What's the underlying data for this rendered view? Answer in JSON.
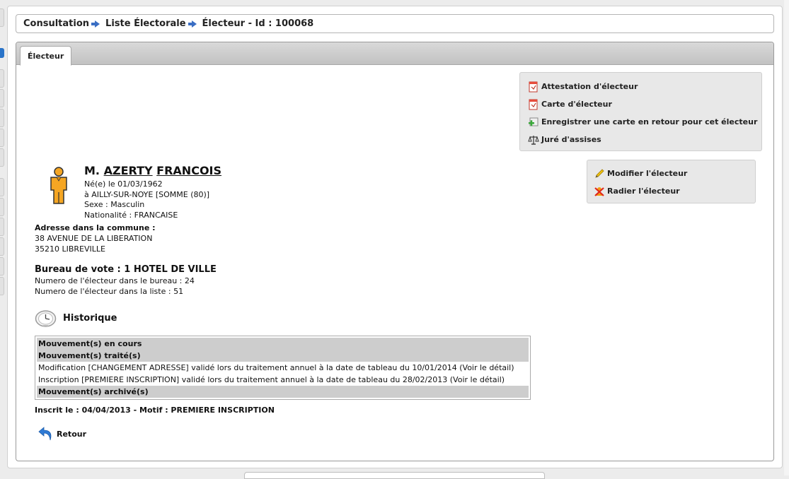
{
  "breadcrumb": {
    "item1": "Consultation",
    "item2": "Liste Électorale",
    "item3": "Électeur - Id : 100068"
  },
  "tabs": [
    {
      "label": "Électeur"
    }
  ],
  "actions": {
    "attestation": "Attestation d'électeur",
    "carte": "Carte d'électeur",
    "enregistrer_retour": "Enregistrer une carte en retour pour cet électeur",
    "jure": "Juré d'assises",
    "modifier": "Modifier l'électeur",
    "radier": "Radier l'électeur"
  },
  "elector": {
    "civilite": "M.",
    "nom": "AZERTY",
    "prenom": "FRANCOIS",
    "naissance": "Né(e) le 01/03/1962",
    "lieu": "à AILLY-SUR-NOYE [SOMME (80)]",
    "sexe": "Sexe : Masculin",
    "nationalite": "Nationalité : FRANCAISE"
  },
  "adresse": {
    "label": "Adresse dans la commune :",
    "ligne1": "38 AVENUE DE LA LIBERATION",
    "ligne2": "35210 LIBREVILLE"
  },
  "bureau": {
    "title": "Bureau de vote : 1 HOTEL DE VILLE",
    "numero_bureau": "Numero de l'électeur dans le bureau : 24",
    "numero_liste": "Numero de l'électeur dans la liste : 51"
  },
  "historique": {
    "title": "Historique",
    "en_cours": "Mouvement(s) en cours",
    "traites": "Mouvement(s) traité(s)",
    "rows": [
      "Modification [CHANGEMENT ADRESSE] validé lors du traitement annuel à la date de tableau du 10/01/2014 (Voir le détail)",
      "Inscription [PREMIERE INSCRIPTION] validé lors du traitement annuel à la date de tableau du 28/02/2013 (Voir le détail)"
    ],
    "archives": "Mouvement(s) archivé(s)"
  },
  "inscrit": "Inscrit le : 04/04/2013 - Motif : PREMIERE INSCRIPTION",
  "retour": "Retour",
  "colors": {
    "accent": "#3a6ec4",
    "person_icon": "#f5a623",
    "section_bg": "#cdcdcd"
  }
}
